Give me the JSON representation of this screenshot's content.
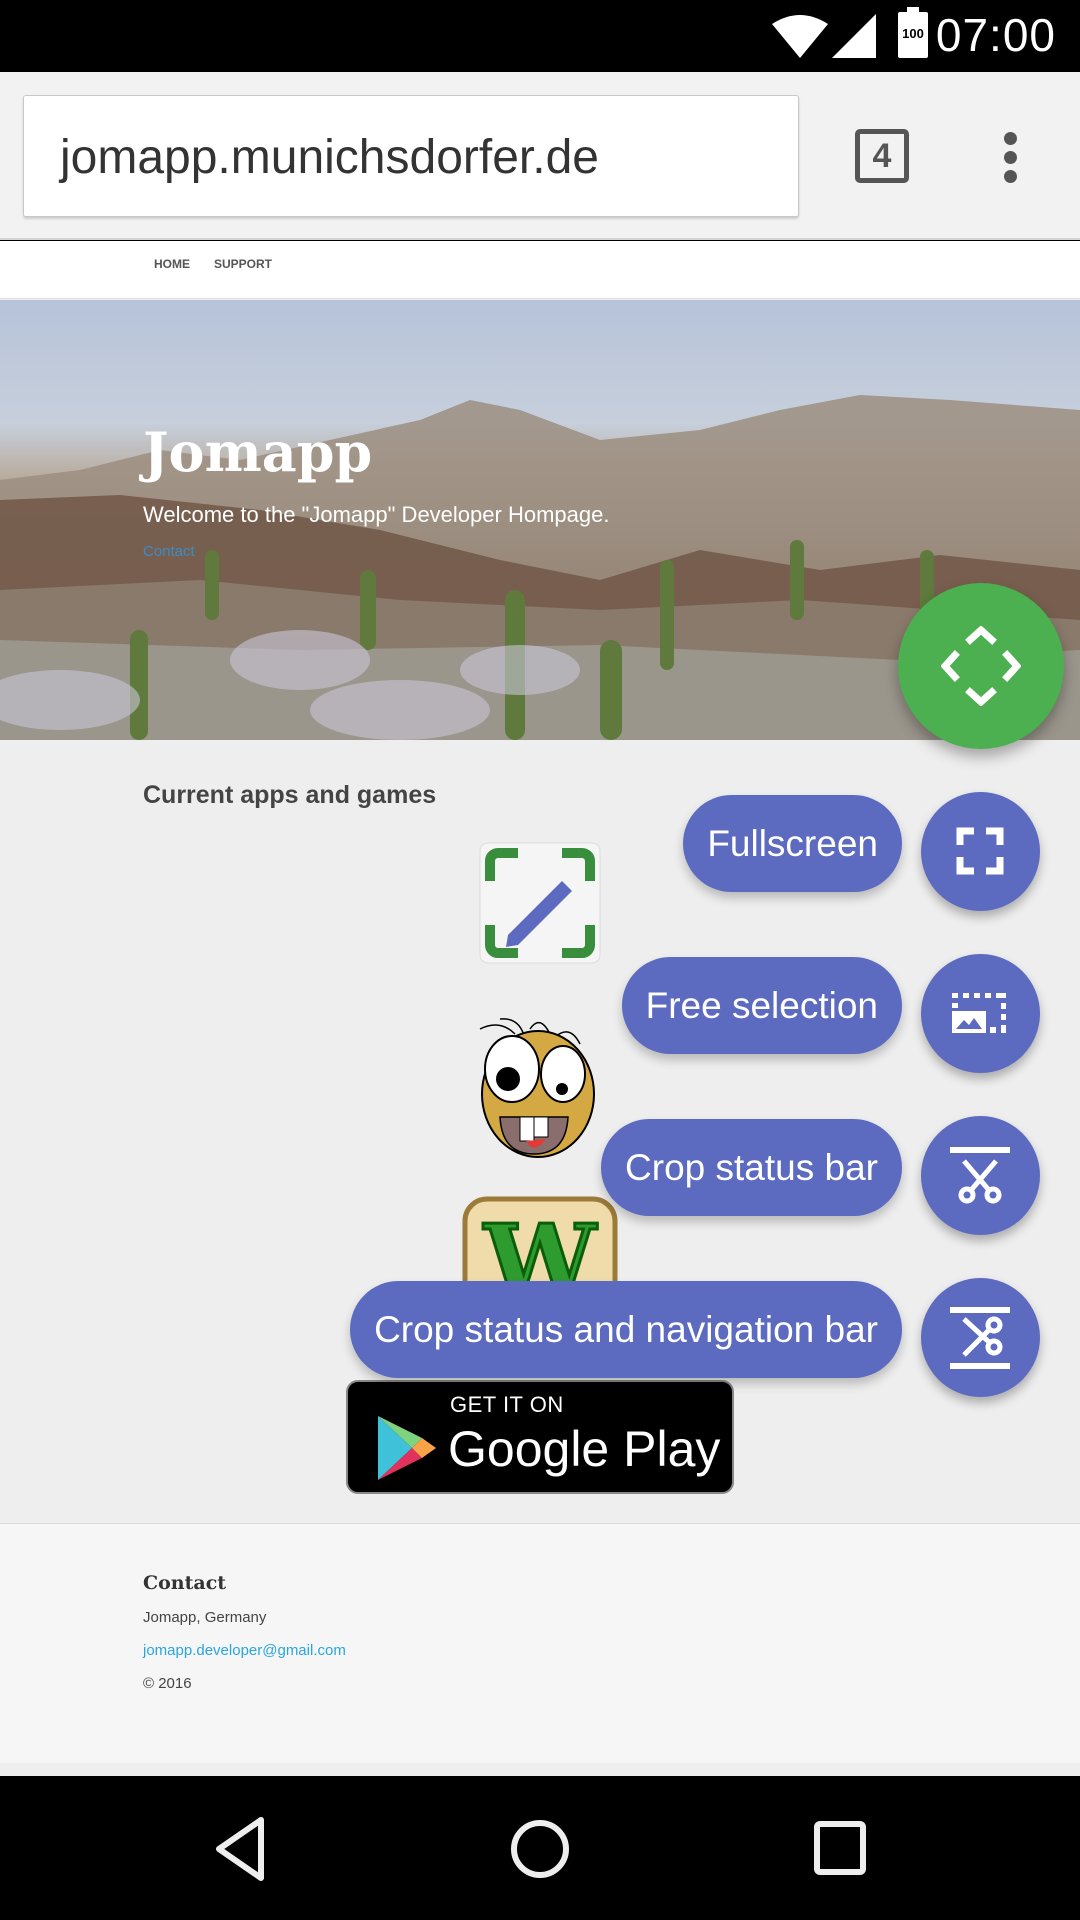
{
  "status_bar": {
    "time": "07:00",
    "battery_level": "100",
    "icons": [
      "wifi-icon",
      "cell-signal-icon",
      "battery-icon"
    ]
  },
  "browser": {
    "url": "jomapp.munichsdorfer.de",
    "tab_count": "4",
    "menu_icon": "more-vert-icon"
  },
  "site": {
    "nav": [
      {
        "label": "HOME"
      },
      {
        "label": "SUPPORT"
      }
    ],
    "hero": {
      "title": "Jomapp",
      "subtitle": "Welcome to the \"Jomapp\" Developer Hompage.",
      "link": "Contact"
    },
    "apps_heading": "Current apps and games",
    "apps": [
      {
        "name": "screenshot-editor-app-icon"
      },
      {
        "name": "cartoon-face-game-icon"
      },
      {
        "name": "w-letter-app-icon"
      }
    ],
    "play_badge": {
      "line1": "GET IT ON",
      "line2": "Google Play"
    },
    "footer": {
      "heading": "Contact",
      "address": "Jomapp, Germany",
      "email": "jomapp.developer@gmail.com",
      "copyright": "© 2016"
    }
  },
  "speed_dial": {
    "main_color": "#4caf50",
    "action_color": "#5c6bc0",
    "actions": [
      {
        "label": "Fullscreen",
        "icon": "fullscreen-icon"
      },
      {
        "label": "Free selection",
        "icon": "free-selection-icon"
      },
      {
        "label": "Crop status bar",
        "icon": "crop-status-bar-icon"
      },
      {
        "label": "Crop status and navigation bar",
        "icon": "crop-status-nav-bar-icon"
      }
    ]
  },
  "nav_bar": {
    "buttons": [
      "back",
      "home",
      "recents"
    ]
  }
}
